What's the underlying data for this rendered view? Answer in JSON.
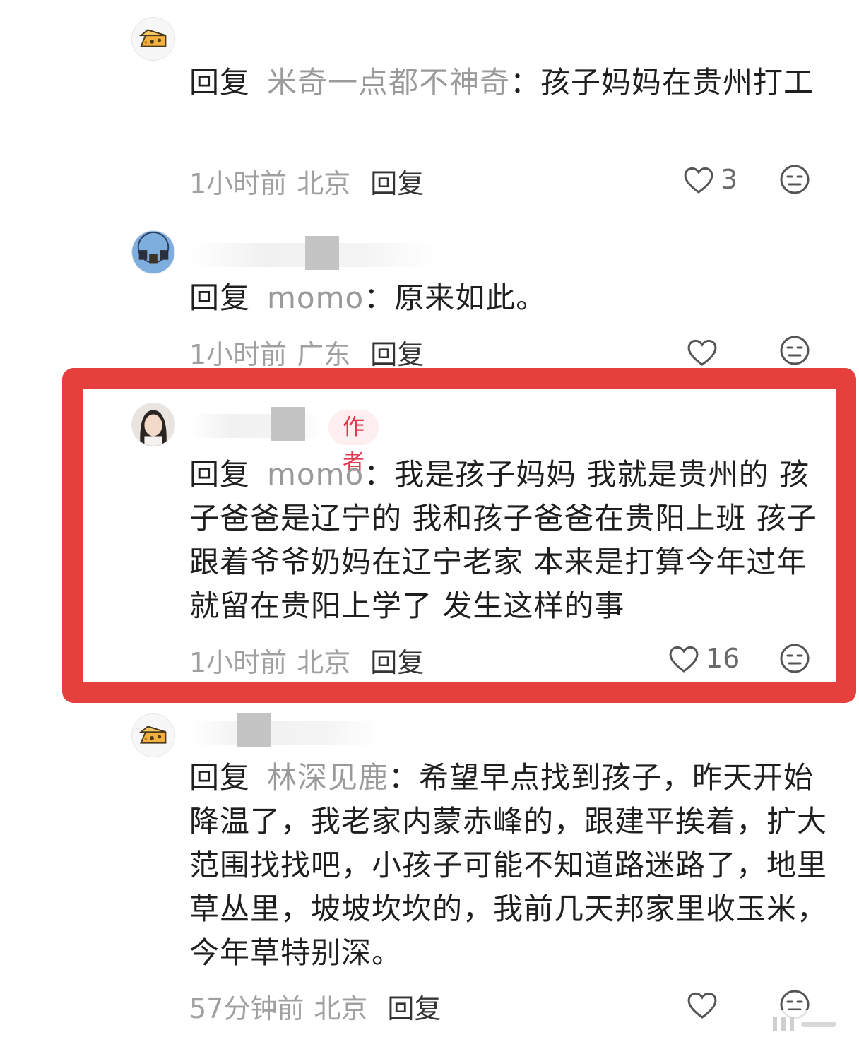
{
  "comments": [
    {
      "reply_label": "回复",
      "reply_target": "米奇一点都不神奇",
      "separator": "：",
      "text": "孩子妈妈在贵州打工",
      "time": "1小时前",
      "location": "北京",
      "reply_button": "回复",
      "likes": "3",
      "avatar_icon": "cheese-icon"
    },
    {
      "reply_label": "回复",
      "reply_target": "momo",
      "separator": "：",
      "text": "原来如此。",
      "time": "1小时前",
      "location": "广东",
      "reply_button": "回复",
      "likes": "",
      "avatar_icon": "ferris-wheel-avatar"
    },
    {
      "author_badge": "作者",
      "reply_label": "回复",
      "reply_target": "momo",
      "separator": "：",
      "text": "我是孩子妈妈 我就是贵州的 孩子爸爸是辽宁的 我和孩子爸爸在贵阳上班 孩子跟着爷爷奶妈在辽宁老家 本来是打算今年过年就留在贵阳上学了 发生这样的事",
      "time": "1小时前",
      "location": "北京",
      "reply_button": "回复",
      "likes": "16",
      "avatar_icon": "girl-photo-avatar",
      "highlight_color": "#e5403b"
    },
    {
      "reply_label": "回复",
      "reply_target": "林深见鹿",
      "separator": "：",
      "text": "希望早点找到孩子，昨天开始降温了，我老家内蒙赤峰的，跟建平挨着，扩大范围找找吧，小孩子可能不知道路迷路了，地里草丛里，坡坡坎坎的，我前几天邦家里收玉米，今年草特别深。",
      "time": "57分钟前",
      "location": "北京",
      "reply_button": "回复",
      "likes": "",
      "avatar_icon": "cheese-icon"
    }
  ],
  "icons": {
    "like": "heart-outline-icon",
    "reaction": "neutral-face-icon",
    "watermark": "weibo-watermark"
  },
  "colors": {
    "highlight_border": "#e5403b",
    "author_badge_text": "#e0384e",
    "author_badge_bg": "#fdeef0",
    "reply_target": "#9a9a9a",
    "meta_gray": "#a0a0a0"
  }
}
